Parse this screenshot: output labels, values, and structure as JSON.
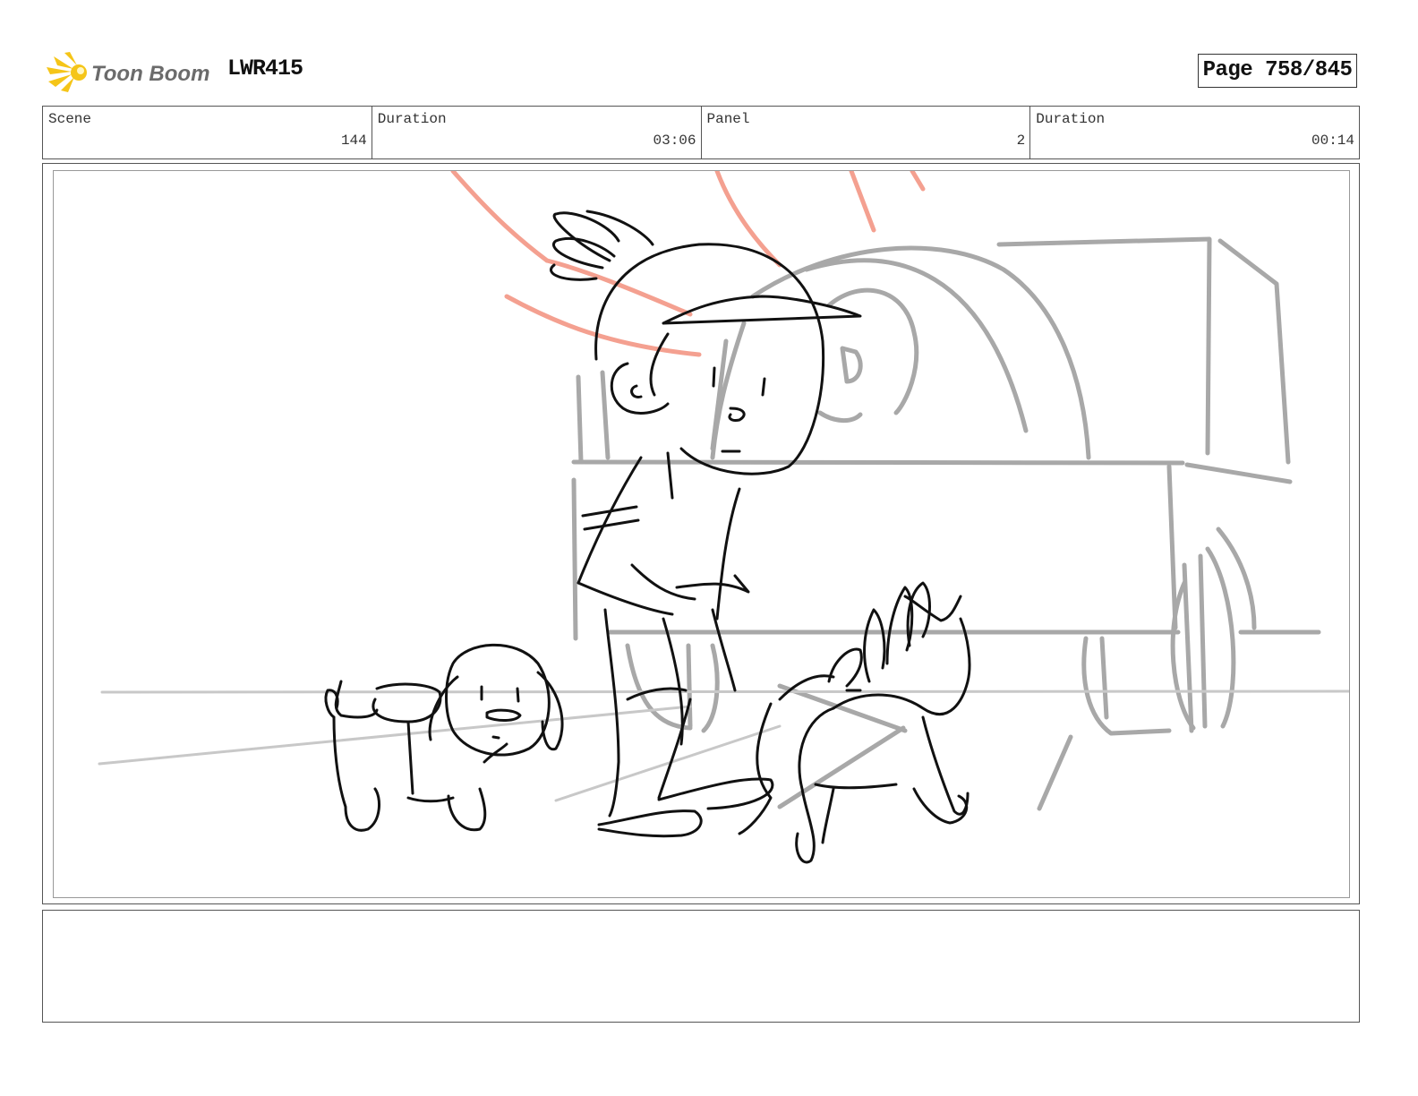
{
  "header": {
    "logo_text": "Toon Boom",
    "project_code": "LWR415",
    "page_label": "Page 758/845"
  },
  "info": {
    "scene_label": "Scene",
    "scene_value": "144",
    "scene_duration_label": "Duration",
    "scene_duration_value": "03:06",
    "panel_label": "Panel",
    "panel_value": "2",
    "panel_duration_label": "Duration",
    "panel_duration_value": "00:14"
  },
  "notes": {
    "text": ""
  },
  "colors": {
    "logo_star": "#f5c518",
    "logo_text": "#6b6b6b",
    "sketch_line": "#111111",
    "background_sketch": "#a8a8a8",
    "red_lines": "#f4a090"
  }
}
